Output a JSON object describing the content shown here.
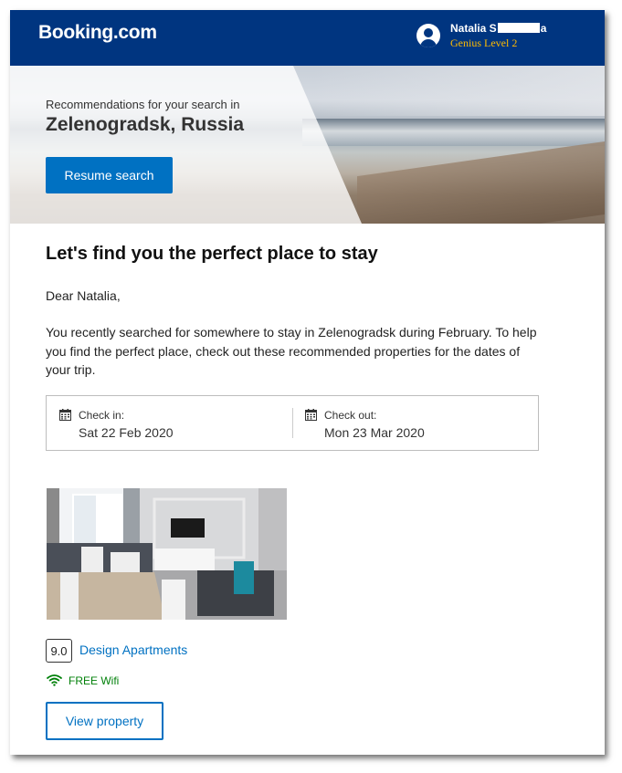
{
  "header": {
    "logo": "Booking.com",
    "user_name_start": "Natalia S",
    "user_name_end": "a",
    "genius_level": "Genius Level 2"
  },
  "hero": {
    "subtitle": "Recommendations for your search in",
    "city": "Zelenogradsk, Russia",
    "resume_button": "Resume search"
  },
  "content": {
    "headline": "Let's find you the perfect place to stay",
    "greeting": "Dear Natalia,",
    "intro": "You recently searched for somewhere to stay in Zelenogradsk during February. To help you find the perfect place, check out these recommended properties for the dates of your trip."
  },
  "dates": {
    "check_in_label": "Check in:",
    "check_in_value": "Sat 22 Feb 2020",
    "check_out_label": "Check out:",
    "check_out_value": "Mon 23 Mar 2020"
  },
  "property": {
    "rating": "9.0",
    "name": "Design Apartments",
    "amenity": "FREE Wifi",
    "view_button": "View property"
  },
  "colors": {
    "brand_blue": "#003580",
    "button_blue": "#0071c2",
    "genius_yellow": "#febb02",
    "wifi_green": "#008009"
  },
  "icons": [
    "user-avatar-icon",
    "calendar-icon",
    "wifi-icon"
  ]
}
